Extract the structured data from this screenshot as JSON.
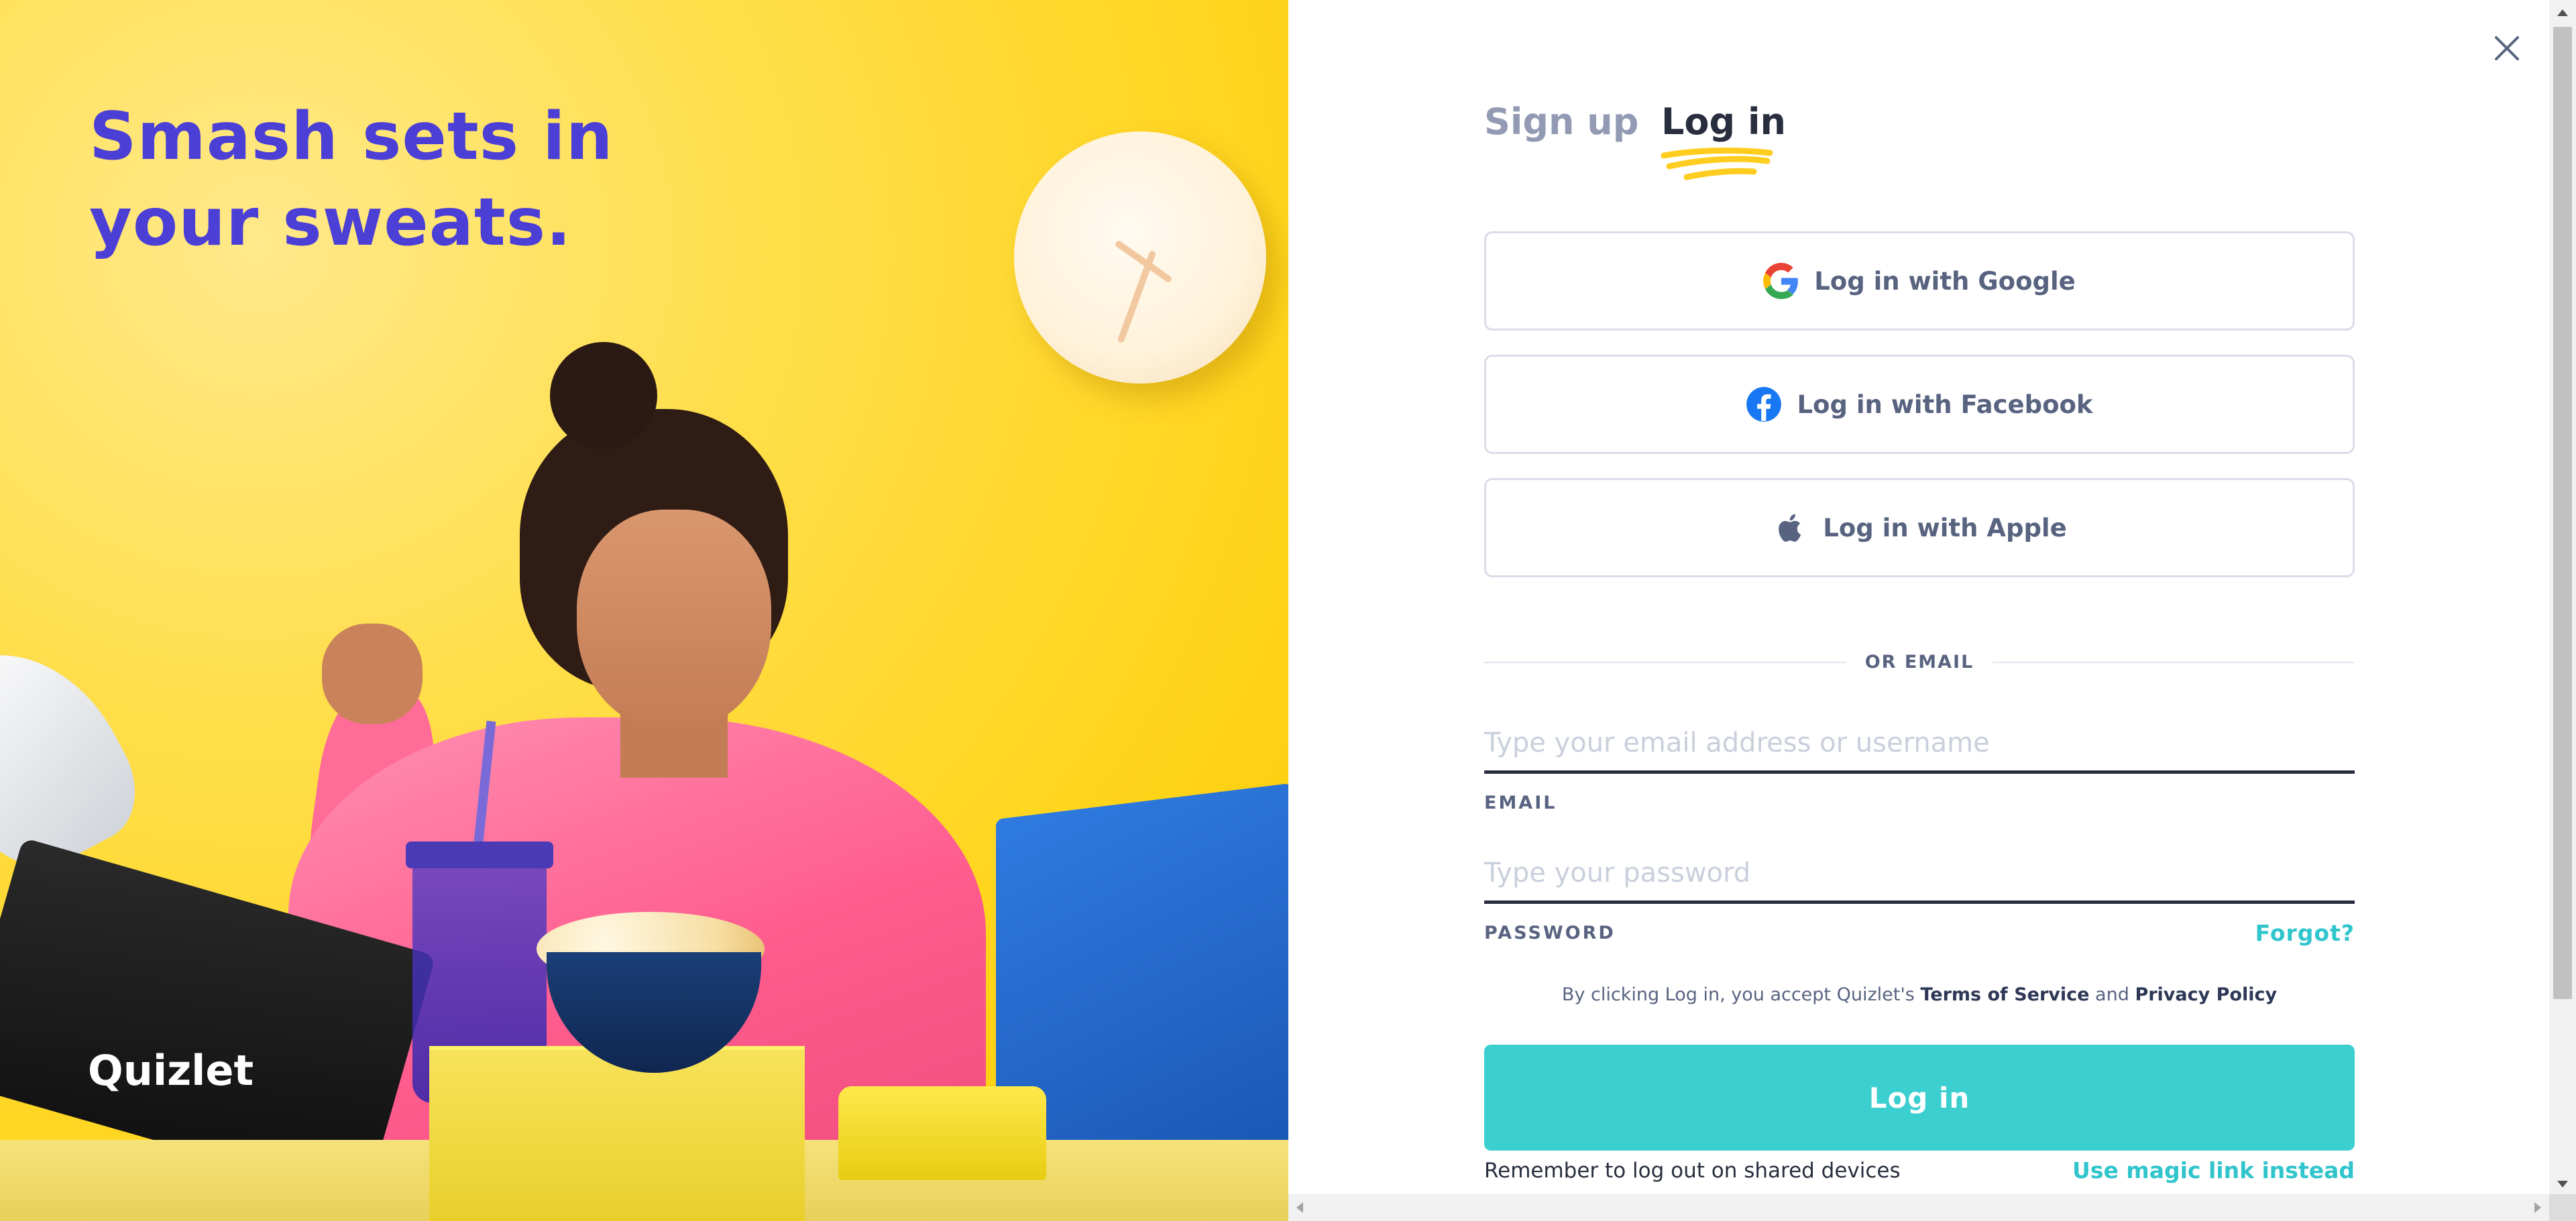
{
  "hero": {
    "headline_line1": "Smash sets in",
    "headline_line2": "your sweats.",
    "brand": "Quizlet"
  },
  "close": {
    "icon": "close-icon"
  },
  "tabs": {
    "signup": "Sign up",
    "login": "Log in",
    "active": "login",
    "accent_color": "#ffcd1f"
  },
  "social": {
    "google": {
      "label": "Log in with Google",
      "icon": "google-icon"
    },
    "facebook": {
      "label": "Log in with Facebook",
      "icon": "facebook-icon"
    },
    "apple": {
      "label": "Log in with Apple",
      "icon": "apple-icon"
    }
  },
  "divider": {
    "text": "OR EMAIL"
  },
  "email": {
    "placeholder": "Type your email address or username",
    "value": "",
    "label": "EMAIL"
  },
  "password": {
    "placeholder": "Type your password",
    "value": "",
    "label": "PASSWORD",
    "forgot": "Forgot?"
  },
  "terms": {
    "prefix": "By clicking Log in, you accept Quizlet's",
    "tos": "Terms of Service",
    "and": "and",
    "privacy": "Privacy Policy"
  },
  "login_button": {
    "label": "Log in",
    "color": "#3ccfcf"
  },
  "footer": {
    "remember": "Remember to log out on shared devices",
    "magic_link": "Use magic link instead"
  },
  "colors": {
    "brand_indigo": "#4b3fd6",
    "text_dark": "#282e3e",
    "text_muted": "#586380",
    "link_teal": "#30c5cc"
  }
}
